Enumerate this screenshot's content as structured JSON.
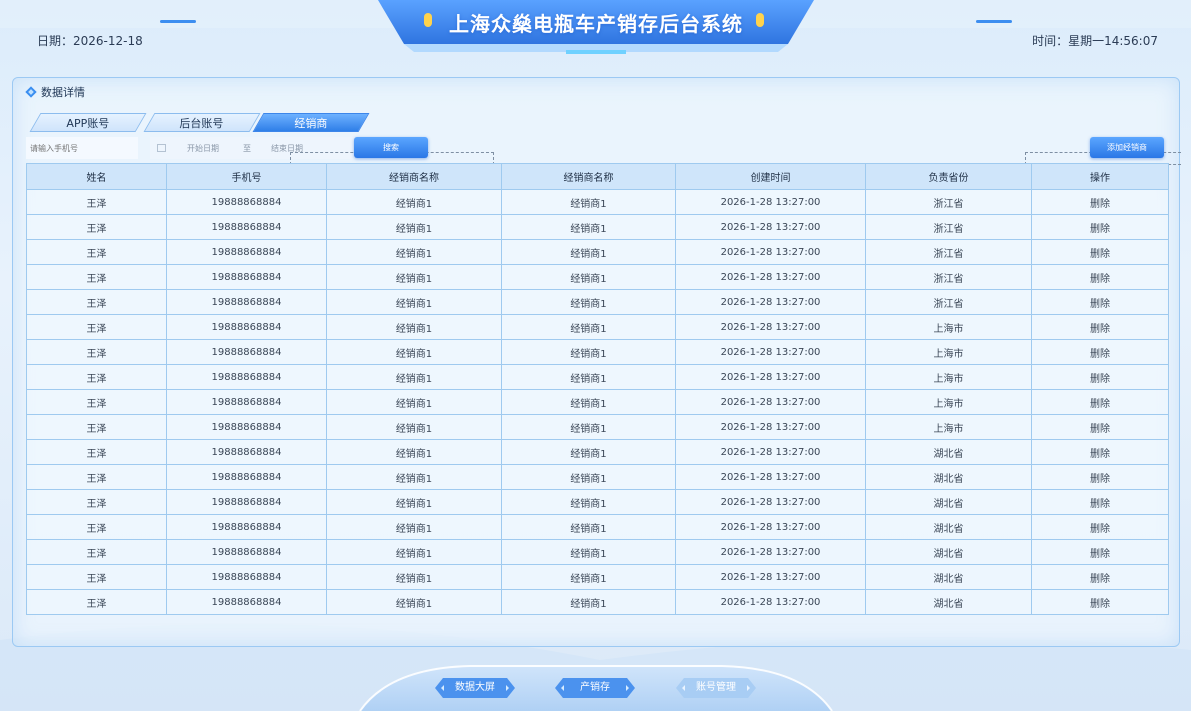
{
  "header": {
    "title": "上海众燊电瓶车产销存后台系统",
    "date_text": "日期：2026-12-18",
    "time_text": "时间：星期一14:56:07"
  },
  "panel": {
    "title": "数据详情"
  },
  "tabs": [
    {
      "label": "APP账号",
      "active": false
    },
    {
      "label": "后台账号",
      "active": false
    },
    {
      "label": "经销商",
      "active": true
    }
  ],
  "filters": {
    "phone_placeholder": "请输入手机号",
    "date_start": "开始日期",
    "date_to": "至",
    "date_end": "结束日期",
    "search_label": "搜索",
    "add_label": "添加经销商"
  },
  "table": {
    "columns": [
      "姓名",
      "手机号",
      "经销商名称",
      "经销商名称",
      "创建时间",
      "负责省份",
      "操作"
    ],
    "rows": [
      [
        "王泽",
        "19888868884",
        "经销商1",
        "经销商1",
        "2026-1-28  13:27:00",
        "浙江省",
        "删除"
      ],
      [
        "王泽",
        "19888868884",
        "经销商1",
        "经销商1",
        "2026-1-28  13:27:00",
        "浙江省",
        "删除"
      ],
      [
        "王泽",
        "19888868884",
        "经销商1",
        "经销商1",
        "2026-1-28  13:27:00",
        "浙江省",
        "删除"
      ],
      [
        "王泽",
        "19888868884",
        "经销商1",
        "经销商1",
        "2026-1-28  13:27:00",
        "浙江省",
        "删除"
      ],
      [
        "王泽",
        "19888868884",
        "经销商1",
        "经销商1",
        "2026-1-28  13:27:00",
        "浙江省",
        "删除"
      ],
      [
        "王泽",
        "19888868884",
        "经销商1",
        "经销商1",
        "2026-1-28  13:27:00",
        "上海市",
        "删除"
      ],
      [
        "王泽",
        "19888868884",
        "经销商1",
        "经销商1",
        "2026-1-28  13:27:00",
        "上海市",
        "删除"
      ],
      [
        "王泽",
        "19888868884",
        "经销商1",
        "经销商1",
        "2026-1-28  13:27:00",
        "上海市",
        "删除"
      ],
      [
        "王泽",
        "19888868884",
        "经销商1",
        "经销商1",
        "2026-1-28  13:27:00",
        "上海市",
        "删除"
      ],
      [
        "王泽",
        "19888868884",
        "经销商1",
        "经销商1",
        "2026-1-28  13:27:00",
        "上海市",
        "删除"
      ],
      [
        "王泽",
        "19888868884",
        "经销商1",
        "经销商1",
        "2026-1-28  13:27:00",
        "湖北省",
        "删除"
      ],
      [
        "王泽",
        "19888868884",
        "经销商1",
        "经销商1",
        "2026-1-28  13:27:00",
        "湖北省",
        "删除"
      ],
      [
        "王泽",
        "19888868884",
        "经销商1",
        "经销商1",
        "2026-1-28  13:27:00",
        "湖北省",
        "删除"
      ],
      [
        "王泽",
        "19888868884",
        "经销商1",
        "经销商1",
        "2026-1-28  13:27:00",
        "湖北省",
        "删除"
      ],
      [
        "王泽",
        "19888868884",
        "经销商1",
        "经销商1",
        "2026-1-28  13:27:00",
        "湖北省",
        "删除"
      ],
      [
        "王泽",
        "19888868884",
        "经销商1",
        "经销商1",
        "2026-1-28  13:27:00",
        "湖北省",
        "删除"
      ],
      [
        "王泽",
        "19888868884",
        "经销商1",
        "经销商1",
        "2026-1-28  13:27:00",
        "湖北省",
        "删除"
      ]
    ]
  },
  "bottom_nav": [
    {
      "label": "数据大屏",
      "active": true
    },
    {
      "label": "产销存",
      "active": true
    },
    {
      "label": "账号管理",
      "active": false
    }
  ],
  "colors": {
    "accent": "#2f7fe8",
    "accent_light": "#6eb1ff",
    "border": "#9fcaef",
    "header_cell": "#cfe5fa",
    "title_dot": "#ffd34d"
  }
}
